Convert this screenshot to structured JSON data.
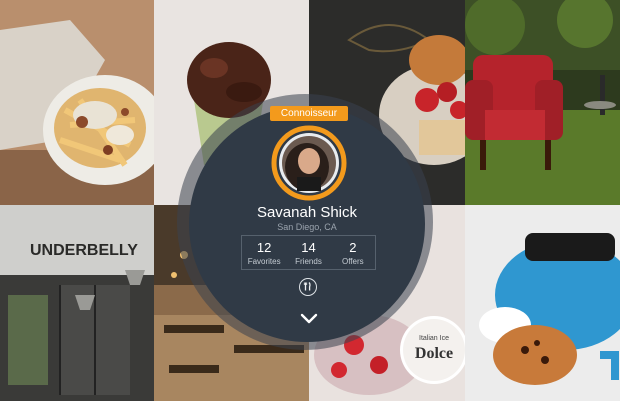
{
  "profile": {
    "badge": "Connoisseur",
    "name": "Savanah Shick",
    "location": "San Diego, CA"
  },
  "stats": [
    {
      "value": "12",
      "label": "Favorites"
    },
    {
      "value": "14",
      "label": "Friends"
    },
    {
      "value": "2",
      "label": "Offers"
    }
  ],
  "background": {
    "sign_text": "UNDERBELLY",
    "cafe_logo_line1": "Italian Ice",
    "cafe_logo_line2": "Dolce"
  },
  "colors": {
    "accent": "#f39a1c",
    "disc": "#303a46"
  },
  "icons": {
    "action": "fork-knife-icon",
    "expand": "chevron-down-icon"
  }
}
